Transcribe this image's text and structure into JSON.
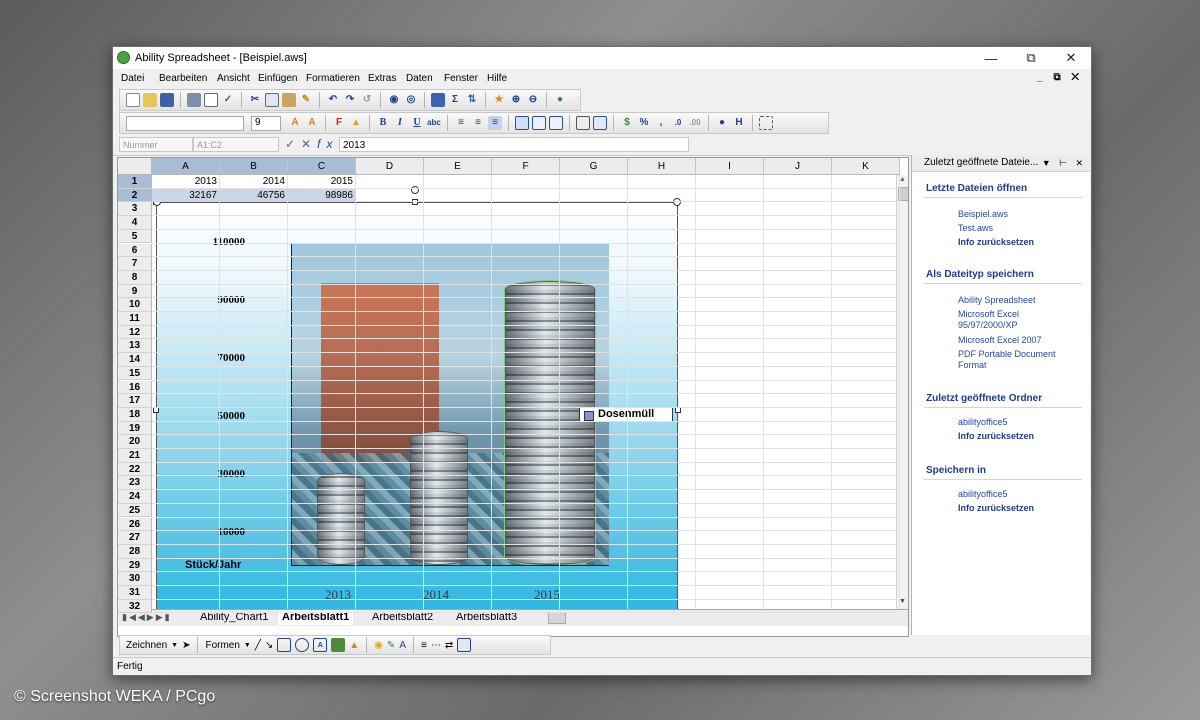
{
  "window": {
    "title": "Ability Spreadsheet - [Beispiel.aws]",
    "min": "—",
    "max": "⧉",
    "close": "✕",
    "mdi": "_ ⧉ ✕"
  },
  "menu": [
    "Datei",
    "Bearbeiten",
    "Ansicht",
    "Einfügen",
    "Formatieren",
    "Extras",
    "Daten",
    "Fenster",
    "Hilfe"
  ],
  "format_toolbar": {
    "font_size": "9",
    "bold": "B",
    "italic": "I",
    "underline": "U",
    "percent": "%",
    "bracket": "H"
  },
  "formula_bar": {
    "name_box": "Nummer",
    "reference": "A1:C2",
    "value": "2013",
    "fx": "fx"
  },
  "columns": [
    "A",
    "B",
    "C",
    "D",
    "E",
    "F",
    "G",
    "H",
    "I",
    "J",
    "K"
  ],
  "selected_columns": [
    "A",
    "B",
    "C"
  ],
  "rows": 32,
  "cells": {
    "A1": "2013",
    "B1": "2014",
    "C1": "2015",
    "A2": "32167",
    "B2": "46756",
    "C2": "98986"
  },
  "chart_data": {
    "type": "bar",
    "categories": [
      "2013",
      "2014",
      "2015"
    ],
    "series": [
      {
        "name": "Dosenmüll",
        "values": [
          32167,
          46756,
          98986
        ]
      }
    ],
    "yticks": [
      "110000",
      "90000",
      "70000",
      "50000",
      "30000",
      "10000"
    ],
    "ylabel": "Stück/Jahr",
    "ylim": [
      0,
      110000
    ],
    "legend_position": "right",
    "colors": {
      "legend_swatch": "#8f8fc8"
    }
  },
  "sheet_tabs": [
    "Ability_Chart1",
    "Arbeitsblatt1",
    "Arbeitsblatt2",
    "Arbeitsblatt3"
  ],
  "active_tab": "Arbeitsblatt1",
  "task_panel": {
    "title": "Zuletzt geöffnete Dateie...",
    "sections": [
      {
        "heading": "Letzte Dateien öffnen",
        "links": [
          "Beispiel.aws",
          "Test.aws"
        ],
        "action": "Info zurücksetzen"
      },
      {
        "heading": "Als Dateityp speichern",
        "links": [
          "Ability Spreadsheet",
          "Microsoft Excel 95/97/2000/XP",
          "Microsoft Excel 2007",
          "PDF Portable Document Format"
        ]
      },
      {
        "heading": "Zuletzt geöffnete Ordner",
        "links": [
          "abilityoffice5"
        ],
        "action": "Info zurücksetzen"
      },
      {
        "heading": "Speichern in",
        "links": [
          "abilityoffice5"
        ],
        "action": "Info zurücksetzen"
      }
    ]
  },
  "draw_toolbar": {
    "draw": "Zeichnen",
    "shapes": "Formen"
  },
  "status": "Fertig",
  "credit": "© Screenshot WEKA / PCgo"
}
